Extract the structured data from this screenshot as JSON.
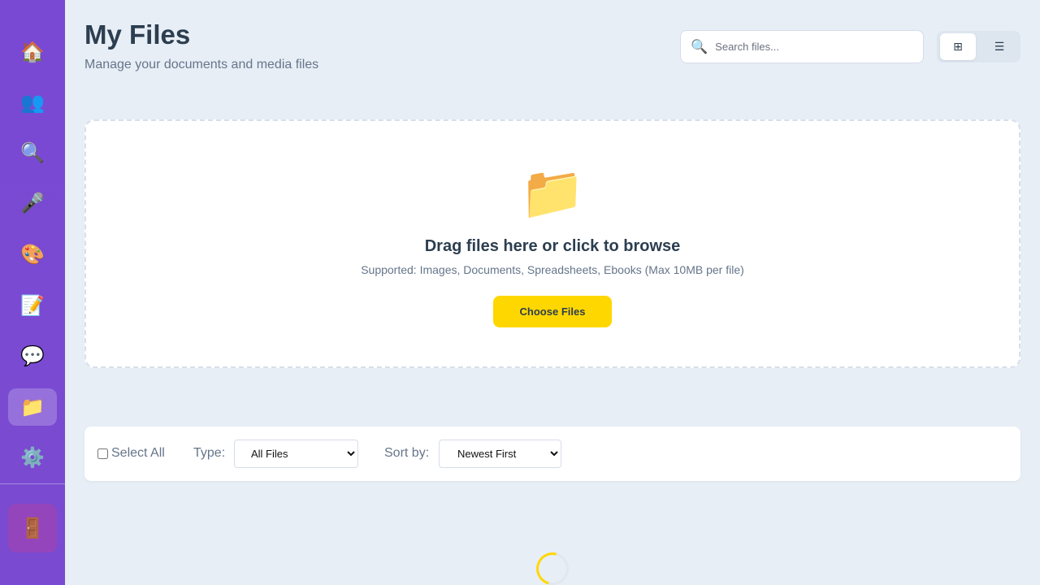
{
  "sidebar": {
    "items": [
      {
        "name": "home",
        "icon": "🏠",
        "active": false
      },
      {
        "name": "people",
        "icon": "👥",
        "active": false
      },
      {
        "name": "search",
        "icon": "🔍",
        "active": false
      },
      {
        "name": "microphone",
        "icon": "🎤",
        "active": false
      },
      {
        "name": "palette",
        "icon": "🎨",
        "active": false
      },
      {
        "name": "notes",
        "icon": "📝",
        "active": false
      },
      {
        "name": "chat",
        "icon": "💬",
        "active": false
      },
      {
        "name": "files",
        "icon": "📁",
        "active": true
      },
      {
        "name": "settings",
        "icon": "⚙️",
        "active": false
      }
    ],
    "logout_icon": "🚪"
  },
  "header": {
    "title": "My Files",
    "subtitle": "Manage your documents and media files"
  },
  "search": {
    "icon": "🔍",
    "placeholder": "Search files..."
  },
  "view_toggle": {
    "grid_icon": "⊞",
    "list_icon": "☰",
    "selected": "grid"
  },
  "upload": {
    "icon": "📁",
    "title": "Drag files here or click to browse",
    "hint": "Supported: Images, Documents, Spreadsheets, Ebooks (Max 10MB per file)",
    "button_label": "Choose Files"
  },
  "filters": {
    "select_all_label": "Select All",
    "type_label": "Type:",
    "type_selected": "All Files",
    "sort_label": "Sort by:",
    "sort_selected": "Newest First"
  },
  "colors": {
    "sidebar": "#7a49d4",
    "accent_button": "#ffd700",
    "background": "#e8eef6"
  }
}
